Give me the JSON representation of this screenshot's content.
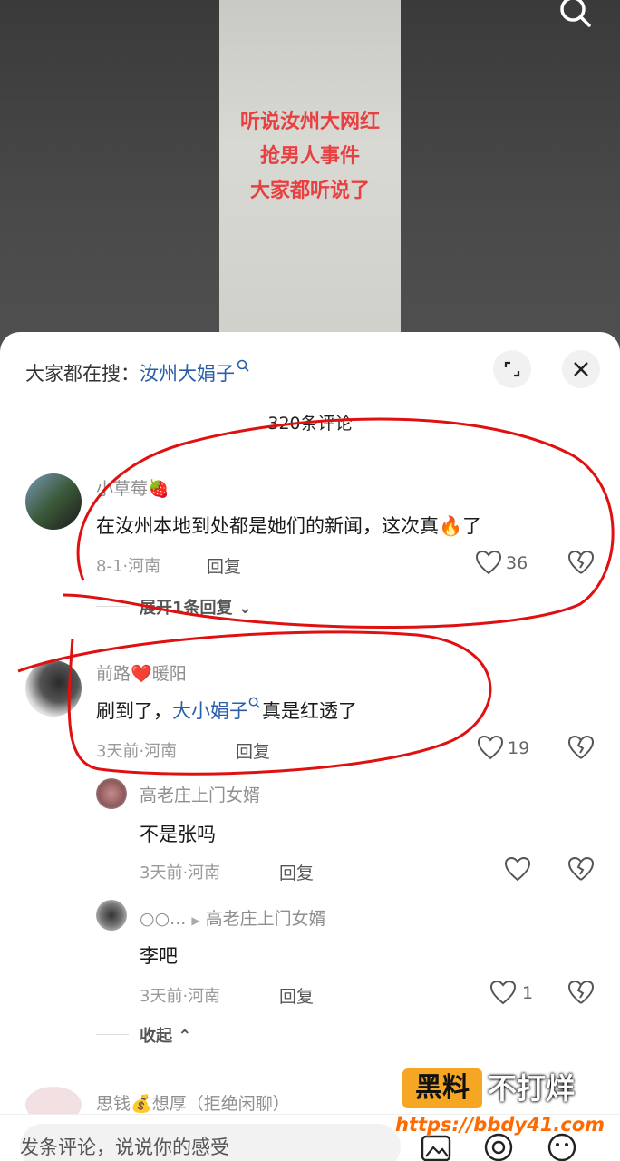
{
  "video": {
    "overlay_lines": [
      "听说汝州大网红",
      "抢男人事件",
      "大家都听说了"
    ]
  },
  "panel": {
    "search_prefix": "大家都在搜：",
    "search_keyword": "汝州大娟子",
    "comment_count": "320条评论"
  },
  "comments": [
    {
      "name": "小草莓🍓",
      "text": "在汝州本地到处都是她们的新闻，这次真🔥了",
      "meta": "8-1·河南",
      "reply_label": "回复",
      "likes": "36",
      "expand_label": "展开1条回复"
    },
    {
      "name_a": "前路",
      "name_b": "暖阳",
      "text_a": "刷到了，",
      "text_link": "大小娟子",
      "text_b": "真是红透了",
      "meta": "3天前·河南",
      "reply_label": "回复",
      "likes": "19"
    }
  ],
  "replies": [
    {
      "name": "高老庄上门女婿",
      "text": "不是张吗",
      "meta": "3天前·河南",
      "reply_label": "回复"
    },
    {
      "name": "○○...",
      "reply_to": "高老庄上门女婿",
      "text": "李吧",
      "meta": "3天前·河南",
      "reply_label": "回复",
      "likes": "1"
    }
  ],
  "collapse_label": "收起",
  "next_comment": {
    "name_a": "思钱",
    "name_b": "想厚（拒绝闲聊）"
  },
  "input": {
    "placeholder": "发条评论，说说你的感受"
  },
  "watermark": {
    "box": "黑料",
    "text": "不打烊",
    "url": "https://bbdy41.com"
  },
  "colors": {
    "link": "#2a5fa8",
    "annotation": "#e01010",
    "overlay": "#e84040"
  }
}
